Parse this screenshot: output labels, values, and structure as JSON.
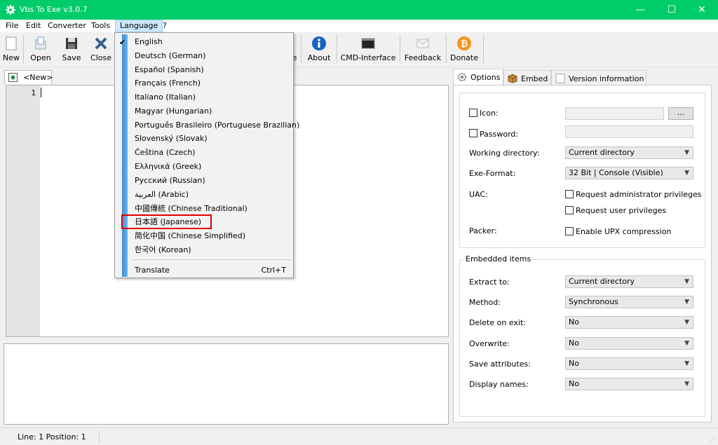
{
  "window": {
    "title": "Vbs To Exe v3.0.7",
    "minimize": "—",
    "maximize": "☐",
    "close": "✕"
  },
  "menu": {
    "file": "File",
    "edit": "Edit",
    "converter": "Converter",
    "tools": "Tools",
    "language": "Language",
    "help": "?"
  },
  "toolbar": {
    "new": "New",
    "open": "Open",
    "save": "Save",
    "close": "Close",
    "about": "About",
    "cmd": "CMD-Interface",
    "feedback": "Feedback",
    "donate": "Donate",
    "partial": "e"
  },
  "doc_tab": {
    "label": "<New>"
  },
  "editor": {
    "line_number": "1"
  },
  "status": {
    "position": "Line: 1  Position: 1"
  },
  "panel_tabs": {
    "options": "Options",
    "embed": "Embed",
    "version": "Version information"
  },
  "options": {
    "icon_label": "Icon:",
    "icon_browse": "...",
    "password_label": "Password:",
    "working_dir_label": "Working directory:",
    "working_dir_value": "Current directory",
    "exe_format_label": "Exe-Format:",
    "exe_format_value": "32 Bit | Console (Visible)",
    "uac_label": "UAC:",
    "uac_admin": "Request administrator privileges",
    "uac_user": "Request user privileges",
    "packer_label": "Packer:",
    "packer_upx": "Enable UPX compression"
  },
  "embedded": {
    "title": "Embedded items",
    "extract_label": "Extract to:",
    "extract_value": "Current directory",
    "method_label": "Method:",
    "method_value": "Synchronous",
    "delete_label": "Delete on exit:",
    "delete_value": "No",
    "overwrite_label": "Overwrite:",
    "overwrite_value": "No",
    "save_attr_label": "Save attributes:",
    "save_attr_value": "No",
    "display_label": "Display names:",
    "display_value": "No"
  },
  "language_menu": {
    "items": [
      "English",
      "Deutsch (German)",
      "Español (Spanish)",
      "Français (French)",
      "Italiano (Italian)",
      "Magyar (Hungarian)",
      "Português Brasileiro (Portuguese Brazilian)",
      "Slovenský (Slovak)",
      "Čeština (Czech)",
      "Ελληνικά (Greek)",
      "Русский (Russian)",
      "العربية (Arabic)",
      "中國傳統 (Chinese Traditional)",
      "日本語 (Japanese)",
      "简化中国 (Chinese Simplified)",
      "한국어 (Korean)"
    ],
    "checked": "English",
    "translate": "Translate",
    "translate_shortcut": "Ctrl+T"
  },
  "colors": {
    "titlebar": "#00cc6a",
    "highlight": "#e00000",
    "menu_strip": "#3a8fd6"
  }
}
